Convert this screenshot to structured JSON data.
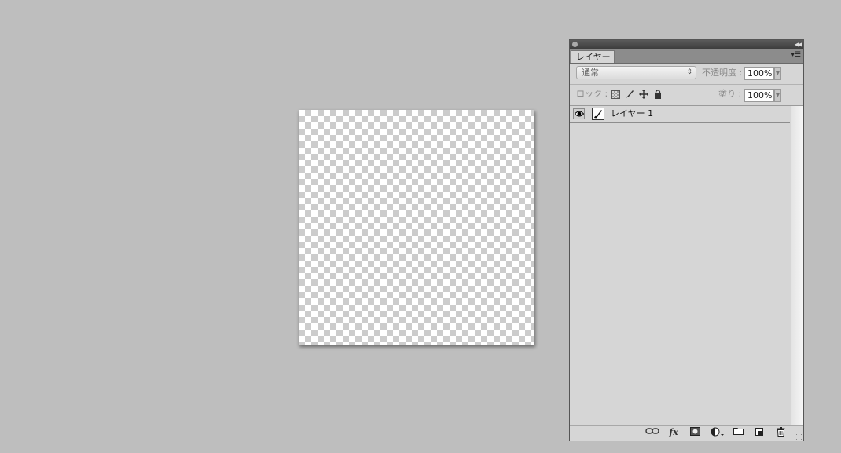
{
  "layers_panel": {
    "tab_label": "レイヤー",
    "blend_mode": "通常",
    "opacity_label": "不透明度 :",
    "opacity_value": "100%",
    "lock_label": "ロック :",
    "fill_label": "塗り :",
    "fill_value": "100%",
    "layers": [
      {
        "name": "レイヤー 1",
        "visible": true
      }
    ],
    "footer_icons": [
      "link-layers-icon",
      "layer-style-fx-icon",
      "add-mask-icon",
      "adjustment-layer-icon",
      "new-group-icon",
      "new-layer-icon",
      "delete-layer-icon"
    ],
    "fx_text": "fx"
  }
}
